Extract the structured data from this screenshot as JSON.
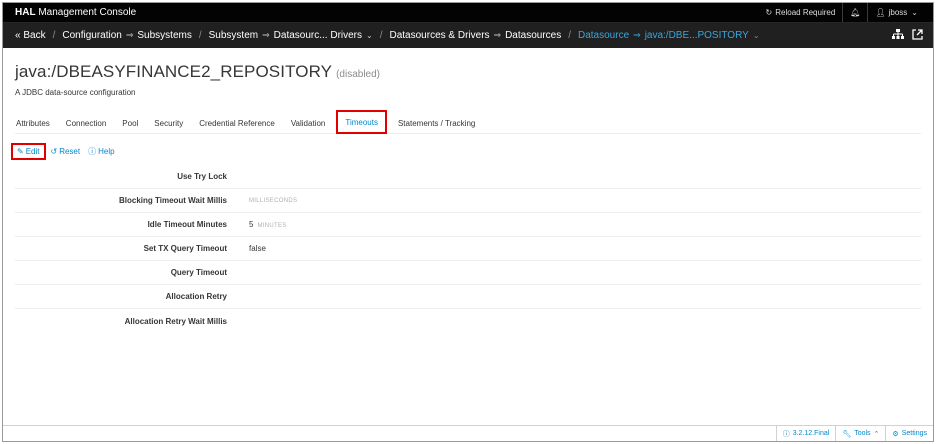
{
  "masthead": {
    "brand_bold": "HAL",
    "brand_rest": " Management Console",
    "reload": "Reload Required",
    "user": "jboss"
  },
  "breadcrumb": {
    "back": "« Back",
    "configuration": "Configuration",
    "subsystems": "Subsystems",
    "subsystem": "Subsystem",
    "datasources_drivers": "Datasourc... Drivers",
    "ds_and_drivers": "Datasources & Drivers",
    "datasources": "Datasources",
    "datasource": "Datasource",
    "current": "java:/DBE...POSITORY"
  },
  "page": {
    "title": "java:/DBEASYFINANCE2_REPOSITORY",
    "state": "(disabled)",
    "subtitle": "A JDBC data-source configuration"
  },
  "tabs": [
    {
      "label": "Attributes"
    },
    {
      "label": "Connection"
    },
    {
      "label": "Pool"
    },
    {
      "label": "Security"
    },
    {
      "label": "Credential Reference"
    },
    {
      "label": "Validation"
    },
    {
      "label": "Timeouts"
    },
    {
      "label": "Statements / Tracking"
    }
  ],
  "toolbar": {
    "edit": "Edit",
    "reset": "Reset",
    "help": "Help"
  },
  "form": [
    {
      "label": "Use Try Lock",
      "value": "",
      "unit": ""
    },
    {
      "label": "Blocking Timeout Wait Millis",
      "value": "",
      "unit": "MILLISECONDS"
    },
    {
      "label": "Idle Timeout Minutes",
      "value": "5",
      "unit": "MINUTES"
    },
    {
      "label": "Set TX Query Timeout",
      "value": "false",
      "unit": ""
    },
    {
      "label": "Query Timeout",
      "value": "",
      "unit": ""
    },
    {
      "label": "Allocation Retry",
      "value": "",
      "unit": ""
    },
    {
      "label": "Allocation Retry Wait Millis",
      "value": "",
      "unit": ""
    }
  ],
  "footer": {
    "version": "3.2.12.Final",
    "tools": "Tools",
    "settings": "Settings"
  },
  "colors": {
    "accent": "#0088ce",
    "highlight": "#e00000",
    "masthead": "#030303"
  }
}
